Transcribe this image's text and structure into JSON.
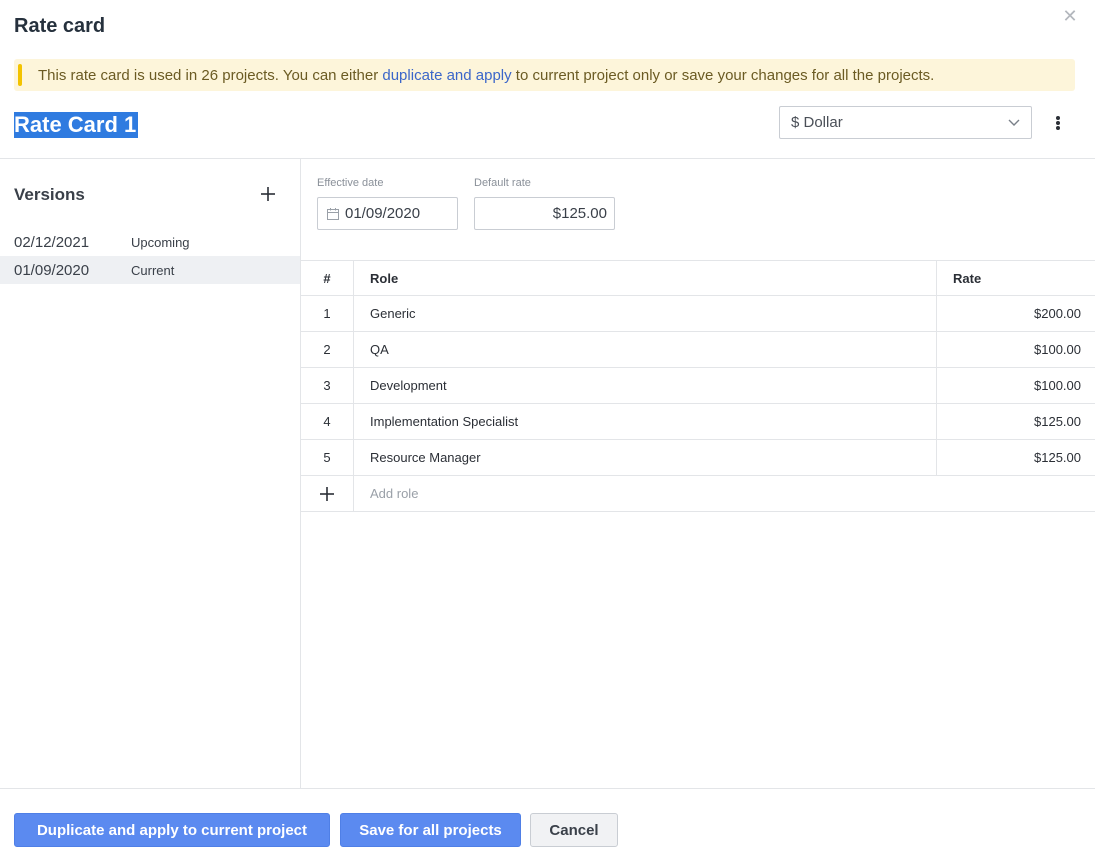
{
  "dialog": {
    "title": "Rate card",
    "close_glyph": "✕"
  },
  "banner": {
    "text_before": "This rate card is used in 26 projects. You can either ",
    "link": "duplicate and apply",
    "text_after": " to current project only or save your changes for all the projects."
  },
  "rate_card": {
    "name": "Rate Card 1",
    "currency": "$ Dollar"
  },
  "versions": {
    "title": "Versions",
    "items": [
      {
        "date": "02/12/2021",
        "status": "Upcoming"
      },
      {
        "date": "01/09/2020",
        "status": "Current"
      }
    ]
  },
  "fields": {
    "effective_date_label": "Effective date",
    "effective_date_value": "01/09/2020",
    "default_rate_label": "Default rate",
    "default_rate_value": "$125.00"
  },
  "table": {
    "headers": {
      "num": "#",
      "role": "Role",
      "rate": "Rate"
    },
    "rows": [
      {
        "num": "1",
        "role": "Generic",
        "rate": "$200.00"
      },
      {
        "num": "2",
        "role": "QA",
        "rate": "$100.00"
      },
      {
        "num": "3",
        "role": "Development",
        "rate": "$100.00"
      },
      {
        "num": "4",
        "role": "Implementation Specialist",
        "rate": "$125.00"
      },
      {
        "num": "5",
        "role": "Resource Manager",
        "rate": "$125.00"
      }
    ],
    "add_role_placeholder": "Add role"
  },
  "footer": {
    "duplicate_label": "Duplicate and apply to current project",
    "save_all_label": "Save for all projects",
    "cancel_label": "Cancel"
  },
  "colors": {
    "primary": "#5b8af0",
    "banner_bg": "#fdf5da",
    "banner_accent": "#f3c300",
    "link": "#3b66c9",
    "selection": "#2f7be0"
  }
}
